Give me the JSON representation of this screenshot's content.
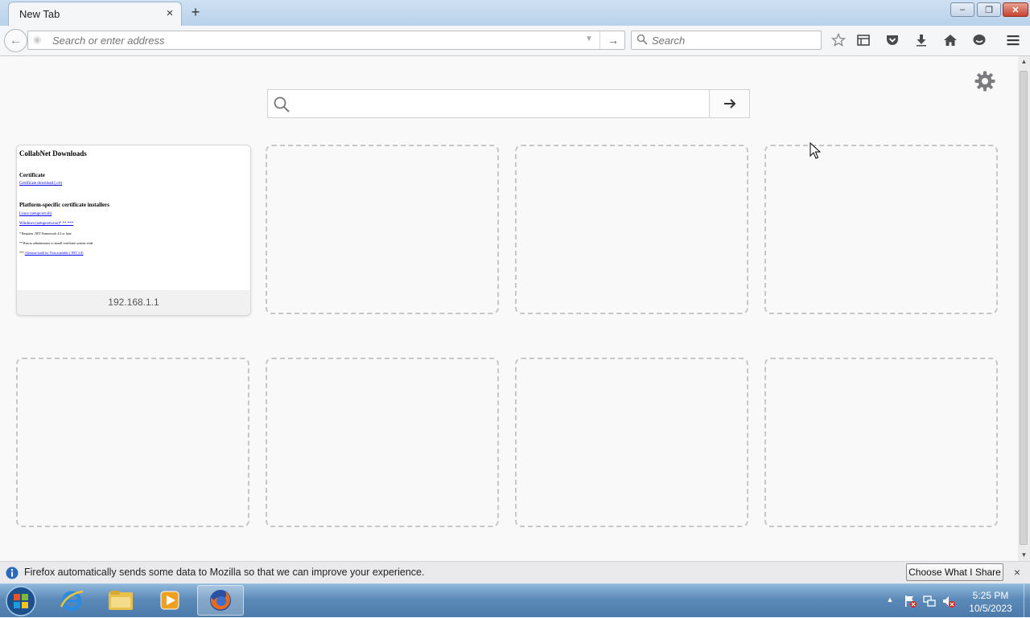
{
  "tab": {
    "title": "New Tab",
    "close_symbol": "×",
    "new_tab_symbol": "+"
  },
  "window": {
    "minimize": "‒",
    "maximize": "❐",
    "close": "✕"
  },
  "navbar": {
    "url_placeholder": "Search or enter address",
    "url_value": "",
    "search_placeholder": "Search",
    "go_symbol": "→",
    "back_symbol": "←",
    "toolbar_icons": [
      "bookmark-star-icon",
      "reading-list-icon",
      "pocket-icon",
      "downloads-icon",
      "home-icon",
      "chat-icon",
      "menu-icon"
    ]
  },
  "newtab": {
    "search_placeholder": "",
    "tiles": [
      {
        "caption": "192.168.1.1",
        "thumbnail": {
          "heading": "CollabNet Downloads",
          "section1": "Certificate",
          "link1": "Certificate download (.crt)",
          "section2": "Platform-specific certificate installers",
          "link2": "Linux (setupcert.sh)",
          "link3": "Windows (setupcert.exe)* ** ***",
          "note1": "* Requires .NET Framework 4.0 or later",
          "note2": "** Run as administrator to install certificate system-wide",
          "note3_prefix": "*** ",
          "note3_link": "Alternate build for Vista available (.NET 2.0)"
        }
      },
      {
        "empty": true
      },
      {
        "empty": true
      },
      {
        "empty": true
      },
      {
        "empty": true
      },
      {
        "empty": true
      },
      {
        "empty": true
      },
      {
        "empty": true
      }
    ]
  },
  "notification": {
    "message": "Firefox automatically sends some data to Mozilla so that we can improve your experience.",
    "button": "Choose What I Share",
    "close_symbol": "×"
  },
  "taskbar": {
    "apps": [
      "internet-explorer",
      "file-explorer",
      "media-player",
      "firefox"
    ],
    "active_app": "firefox",
    "clock": {
      "time": "5:25 PM",
      "date": "10/5/2023"
    },
    "tray_arrow": "▲"
  },
  "colors": {
    "accent": "#0a84ff",
    "taskbar": "#5c8ab8",
    "close_red": "#c7432f"
  }
}
